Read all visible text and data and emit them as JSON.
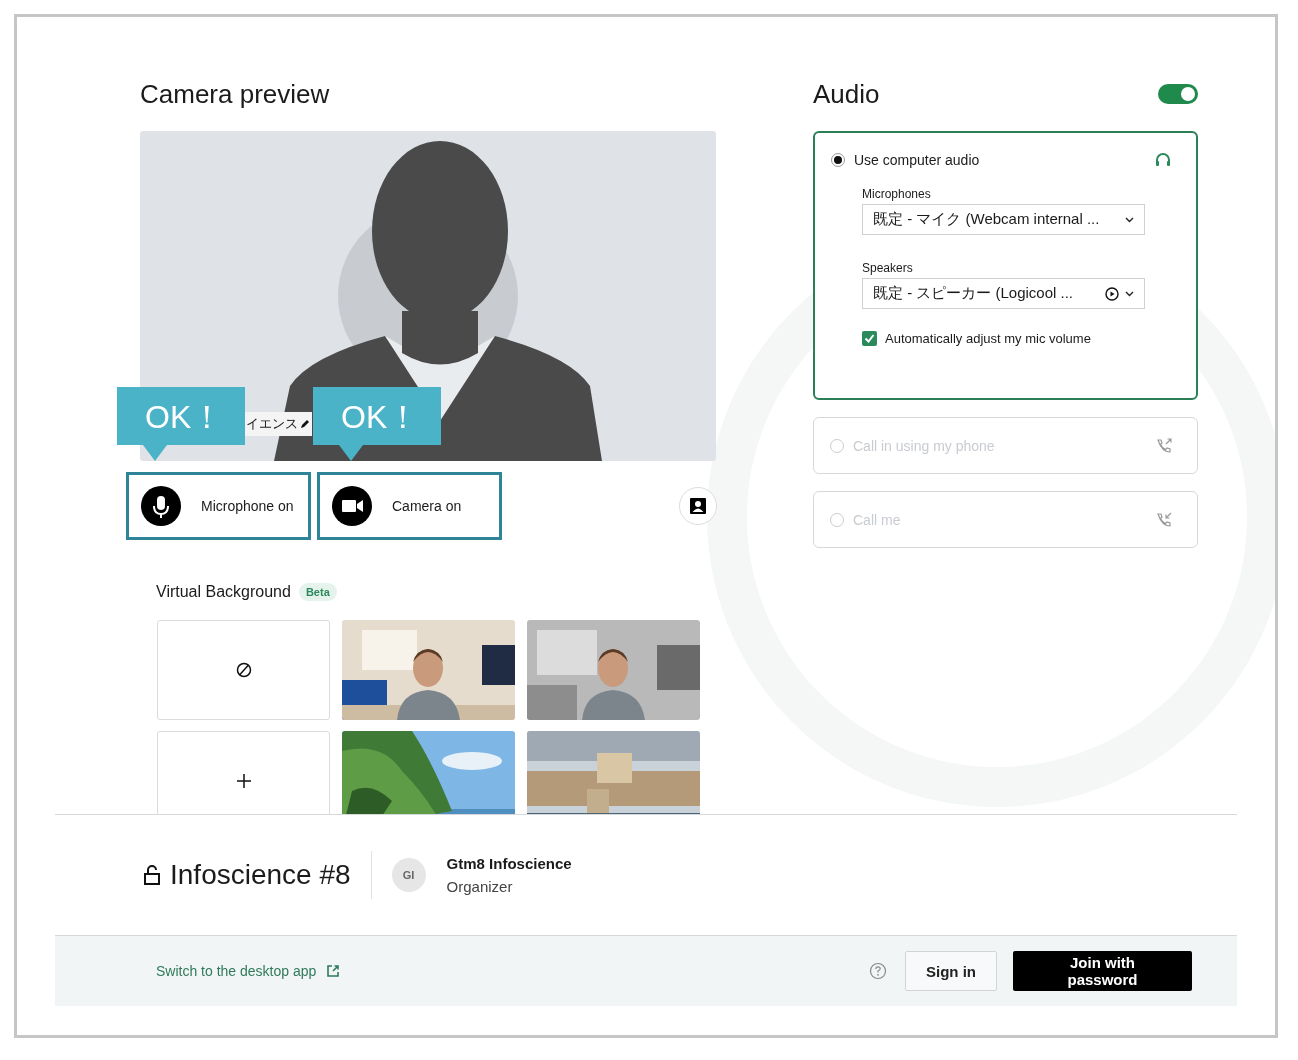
{
  "camera": {
    "title": "Camera preview",
    "name_tag": "イエンス",
    "callouts": [
      "OK！",
      "OK！"
    ],
    "controls": [
      {
        "kind": "mic",
        "label": "Microphone on"
      },
      {
        "kind": "camera",
        "label": "Camera on"
      }
    ]
  },
  "virtual_background": {
    "title": "Virtual Background",
    "badge": "Beta",
    "tiles": [
      {
        "kind": "none"
      },
      {
        "kind": "picture"
      },
      {
        "kind": "picture"
      },
      {
        "kind": "add"
      },
      {
        "kind": "picture"
      },
      {
        "kind": "picture"
      }
    ]
  },
  "audio": {
    "title": "Audio",
    "on": true,
    "options": [
      {
        "kind": "computer",
        "label": "Use computer audio",
        "selected": true,
        "microphones_label": "Microphones",
        "microphone": "既定 - マイク (Webcam internal ...",
        "speakers_label": "Speakers",
        "speaker": "既定 - スピーカー (Logicool ...",
        "auto_adjust": {
          "label": "Automatically adjust my mic volume",
          "checked": true
        }
      },
      {
        "kind": "call_in",
        "label": "Call in using my phone",
        "selected": false
      },
      {
        "kind": "call_me",
        "label": "Call me",
        "selected": false
      }
    ]
  },
  "meeting": {
    "title": "Infoscience #8",
    "host_initials": "GI",
    "host_name": "Gtm8 Infoscience",
    "host_role": "Organizer"
  },
  "footer": {
    "link": "Switch to the desktop app",
    "buttons": [
      "Sign in",
      "Join with password"
    ]
  }
}
